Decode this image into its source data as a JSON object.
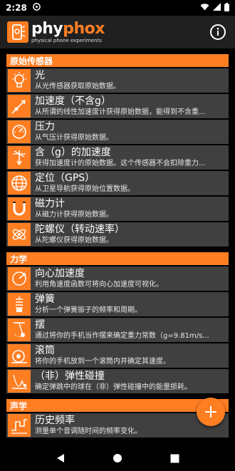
{
  "status_bar": {
    "time": "2:28"
  },
  "app_bar": {
    "brand_name_a": "phy",
    "brand_name_b": "phox",
    "tagline": "physical phone experiments"
  },
  "categories": [
    {
      "header": "原始传感器",
      "items": [
        {
          "title": "光",
          "desc": "从光传感器获取原始数据。",
          "icon": "light-bulb-icon"
        },
        {
          "title": "加速度（不含g）",
          "desc": "从所谓的线性加速度计获得原始数据，能得到不含重...",
          "icon": "accelerometer-icon"
        },
        {
          "title": "压力",
          "desc": "从气压计获得原始数据。",
          "icon": "pressure-gauge-icon"
        },
        {
          "title": "含（g）的加速度",
          "desc": "获得加速度计的原始数据。这个传感器不会扣除重力...",
          "icon": "gravity-accelerometer-icon"
        },
        {
          "title": "定位（GPS）",
          "desc": "从卫星导航获得原始位置数据。",
          "icon": "globe-icon"
        },
        {
          "title": "磁力计",
          "desc": "从磁力计获得原始数据。",
          "icon": "magnet-icon"
        },
        {
          "title": "陀螺仪（转动速率）",
          "desc": "从陀螺仪获得原始数据。",
          "icon": "gyroscope-icon"
        }
      ]
    },
    {
      "header": "力学",
      "items": [
        {
          "title": "向心加速度",
          "desc": "利用角速度函数可将向心加速度可视化。",
          "icon": "centripetal-icon"
        },
        {
          "title": "弹簧",
          "desc": "分析一个弹簧振子的频率和周期。",
          "icon": "spring-icon"
        },
        {
          "title": "摆",
          "desc": "通过将你的手机当作摆来确定重力常数（g=9.81m/s...",
          "icon": "pendulum-icon"
        },
        {
          "title": "滚筒",
          "desc": "将你的手机放到一个滚筒内并确定其速度。",
          "icon": "roll-icon"
        },
        {
          "title": "（非）弹性碰撞",
          "desc": "确定弹跳中的球在（非）弹性碰撞中的能量损耗。",
          "icon": "collision-icon"
        }
      ]
    },
    {
      "header": "声学",
      "items": [
        {
          "title": "历史频率",
          "desc": "测量单个音调随时间的频率变化。",
          "icon": "frequency-icon"
        }
      ]
    }
  ],
  "colors": {
    "accent": "#ff7e22",
    "item_bg": "#404040",
    "app_bar_bg": "#202020"
  }
}
